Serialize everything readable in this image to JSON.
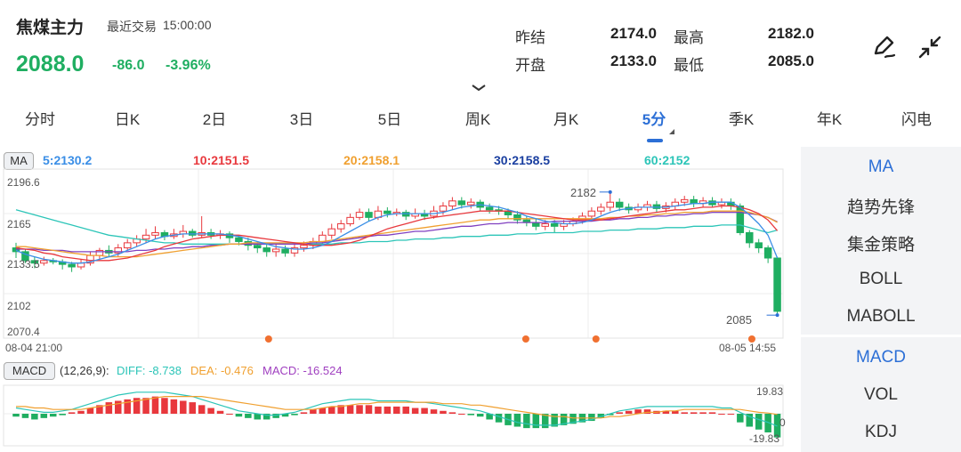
{
  "header": {
    "title": "焦煤主力",
    "last_trade_label": "最近交易",
    "last_trade_time": "15:00:00",
    "price": "2088.0",
    "change": "-86.0",
    "change_pct": "-3.96%",
    "prev_settle_label": "昨结",
    "prev_settle": "2174.0",
    "high_label": "最高",
    "high": "2182.0",
    "open_label": "开盘",
    "open": "2133.0",
    "low_label": "最低",
    "low": "2085.0"
  },
  "tabs": [
    "分时",
    "日K",
    "2日",
    "3日",
    "5日",
    "周K",
    "月K",
    "5分",
    "季K",
    "年K",
    "闪电"
  ],
  "active_tab": "5分",
  "ma": {
    "tag": "MA",
    "ma5": "5:2130.2",
    "ma10": "10:2151.5",
    "ma20": "20:2158.1",
    "ma30": "30:2158.5",
    "ma60": "60:2152"
  },
  "macd": {
    "tag": "MACD",
    "params": "(12,26,9):",
    "diff": "DIFF: -8.738",
    "dea": "DEA: -0.476",
    "macd": "MACD: -16.524"
  },
  "axis": {
    "y_ticks": [
      "2196.6",
      "2165",
      "2133.5",
      "2102",
      "2070.4"
    ],
    "x_start": "08-04 21:00",
    "x_end": "08-05 14:55",
    "macd_top": "19.83",
    "macd_zero": "0",
    "macd_bottom": "-19.83",
    "high_mark": "2182",
    "low_mark": "2085"
  },
  "side_menu": [
    "MA",
    "趋势先锋",
    "集金策略",
    "BOLL",
    "MABOLL",
    "MACD",
    "VOL",
    "KDJ"
  ],
  "colors": {
    "up": "#e8383d",
    "down": "#1fae61",
    "active": "#2c6fd6",
    "ma5": "#3a8ee6",
    "ma10": "#e8383d",
    "ma20": "#f0a030",
    "ma30": "#1a3fa0",
    "ma60": "#2cc5b8"
  },
  "chart_data": {
    "type": "candlestick",
    "ylim": [
      2070.4,
      2196.6
    ],
    "candles": [
      [
        2138,
        2135,
        2142,
        2130
      ],
      [
        2135,
        2128,
        2137,
        2126
      ],
      [
        2128,
        2126,
        2131,
        2122
      ],
      [
        2126,
        2128,
        2131,
        2124
      ],
      [
        2128,
        2127,
        2130,
        2125
      ],
      [
        2127,
        2125,
        2129,
        2121
      ],
      [
        2125,
        2123,
        2127,
        2119
      ],
      [
        2123,
        2126,
        2129,
        2121
      ],
      [
        2126,
        2132,
        2135,
        2124
      ],
      [
        2132,
        2136,
        2138,
        2129
      ],
      [
        2136,
        2134,
        2140,
        2131
      ],
      [
        2134,
        2138,
        2141,
        2131
      ],
      [
        2138,
        2142,
        2145,
        2136
      ],
      [
        2142,
        2145,
        2148,
        2139
      ],
      [
        2145,
        2148,
        2153,
        2142
      ],
      [
        2148,
        2150,
        2155,
        2145
      ],
      [
        2150,
        2147,
        2152,
        2144
      ],
      [
        2147,
        2149,
        2153,
        2145
      ],
      [
        2149,
        2151,
        2156,
        2146
      ],
      [
        2151,
        2148,
        2153,
        2146
      ],
      [
        2148,
        2150,
        2163,
        2146
      ],
      [
        2150,
        2148,
        2153,
        2145
      ],
      [
        2148,
        2149,
        2152,
        2145
      ],
      [
        2149,
        2146,
        2151,
        2142
      ],
      [
        2146,
        2143,
        2148,
        2140
      ],
      [
        2143,
        2140,
        2146,
        2136
      ],
      [
        2140,
        2138,
        2143,
        2134
      ],
      [
        2138,
        2135,
        2141,
        2131
      ],
      [
        2135,
        2137,
        2142,
        2131
      ],
      [
        2137,
        2134,
        2140,
        2131
      ],
      [
        2134,
        2138,
        2142,
        2131
      ],
      [
        2138,
        2140,
        2143,
        2135
      ],
      [
        2140,
        2143,
        2146,
        2137
      ],
      [
        2143,
        2148,
        2151,
        2141
      ],
      [
        2148,
        2153,
        2157,
        2145
      ],
      [
        2153,
        2157,
        2160,
        2150
      ],
      [
        2157,
        2162,
        2165,
        2155
      ],
      [
        2162,
        2166,
        2169,
        2160
      ],
      [
        2166,
        2162,
        2169,
        2159
      ],
      [
        2162,
        2167,
        2171,
        2160
      ],
      [
        2167,
        2165,
        2170,
        2162
      ],
      [
        2165,
        2166,
        2169,
        2163
      ],
      [
        2166,
        2163,
        2168,
        2160
      ],
      [
        2163,
        2165,
        2169,
        2161
      ],
      [
        2165,
        2163,
        2168,
        2160
      ],
      [
        2163,
        2167,
        2171,
        2161
      ],
      [
        2167,
        2171,
        2174,
        2164
      ],
      [
        2171,
        2175,
        2178,
        2168
      ],
      [
        2175,
        2172,
        2178,
        2169
      ],
      [
        2172,
        2174,
        2177,
        2169
      ],
      [
        2174,
        2170,
        2176,
        2167
      ],
      [
        2170,
        2168,
        2173,
        2165
      ],
      [
        2168,
        2167,
        2171,
        2164
      ],
      [
        2167,
        2164,
        2169,
        2161
      ],
      [
        2164,
        2160,
        2167,
        2157
      ],
      [
        2160,
        2158,
        2163,
        2155
      ],
      [
        2158,
        2155,
        2161,
        2152
      ],
      [
        2155,
        2157,
        2160,
        2152
      ],
      [
        2157,
        2155,
        2160,
        2150
      ],
      [
        2155,
        2157,
        2160,
        2152
      ],
      [
        2157,
        2159,
        2162,
        2155
      ],
      [
        2159,
        2163,
        2166,
        2157
      ],
      [
        2163,
        2167,
        2170,
        2160
      ],
      [
        2167,
        2170,
        2173,
        2164
      ],
      [
        2170,
        2174,
        2182,
        2167
      ],
      [
        2174,
        2170,
        2177,
        2167
      ],
      [
        2170,
        2168,
        2173,
        2165
      ],
      [
        2168,
        2170,
        2173,
        2166
      ],
      [
        2170,
        2172,
        2175,
        2167
      ],
      [
        2172,
        2169,
        2175,
        2166
      ],
      [
        2169,
        2171,
        2174,
        2166
      ],
      [
        2171,
        2174,
        2177,
        2168
      ],
      [
        2174,
        2176,
        2179,
        2171
      ],
      [
        2176,
        2173,
        2179,
        2170
      ],
      [
        2173,
        2175,
        2178,
        2170
      ],
      [
        2175,
        2172,
        2178,
        2170
      ],
      [
        2172,
        2174,
        2177,
        2169
      ],
      [
        2174,
        2171,
        2177,
        2168
      ],
      [
        2171,
        2150,
        2173,
        2148
      ],
      [
        2150,
        2142,
        2152,
        2138
      ],
      [
        2142,
        2138,
        2145,
        2134
      ],
      [
        2138,
        2130,
        2140,
        2126
      ],
      [
        2130,
        2088,
        2131,
        2085
      ]
    ],
    "ma5": [
      2136,
      2133,
      2131,
      2129,
      2128,
      2127,
      2126,
      2126,
      2127,
      2129,
      2131,
      2133,
      2136,
      2139,
      2142,
      2145,
      2147,
      2148,
      2149,
      2149,
      2149,
      2149,
      2149,
      2148,
      2147,
      2145,
      2143,
      2141,
      2139,
      2138,
      2137,
      2137,
      2138,
      2140,
      2143,
      2147,
      2151,
      2155,
      2159,
      2162,
      2164,
      2165,
      2165,
      2165,
      2165,
      2165,
      2166,
      2168,
      2170,
      2171,
      2172,
      2171,
      2170,
      2168,
      2166,
      2163,
      2161,
      2159,
      2158,
      2157,
      2157,
      2158,
      2160,
      2163,
      2166,
      2168,
      2169,
      2170,
      2170,
      2170,
      2170,
      2171,
      2172,
      2173,
      2173,
      2174,
      2174,
      2174,
      2170,
      2164,
      2157,
      2148,
      2130
    ],
    "ma10": [
      2138,
      2137,
      2136,
      2134,
      2133,
      2131,
      2130,
      2129,
      2128,
      2128,
      2128,
      2129,
      2130,
      2132,
      2134,
      2136,
      2139,
      2141,
      2143,
      2145,
      2146,
      2147,
      2148,
      2148,
      2148,
      2147,
      2146,
      2145,
      2144,
      2143,
      2142,
      2141,
      2140,
      2140,
      2140,
      2141,
      2142,
      2144,
      2147,
      2150,
      2153,
      2155,
      2157,
      2159,
      2161,
      2162,
      2163,
      2164,
      2165,
      2166,
      2167,
      2167,
      2167,
      2167,
      2166,
      2165,
      2164,
      2163,
      2162,
      2161,
      2160,
      2160,
      2160,
      2160,
      2161,
      2162,
      2163,
      2164,
      2165,
      2166,
      2167,
      2168,
      2168,
      2169,
      2170,
      2170,
      2171,
      2171,
      2170,
      2168,
      2165,
      2160,
      2151.5
    ],
    "ma20": [
      2139,
      2139,
      2138,
      2137,
      2136,
      2135,
      2134,
      2133,
      2132,
      2132,
      2131,
      2131,
      2131,
      2131,
      2132,
      2133,
      2134,
      2135,
      2136,
      2137,
      2138,
      2139,
      2140,
      2141,
      2141,
      2142,
      2142,
      2142,
      2142,
      2142,
      2142,
      2142,
      2143,
      2143,
      2144,
      2145,
      2146,
      2147,
      2148,
      2149,
      2150,
      2151,
      2152,
      2153,
      2154,
      2155,
      2156,
      2157,
      2158,
      2159,
      2160,
      2160,
      2161,
      2161,
      2161,
      2161,
      2161,
      2161,
      2161,
      2161,
      2161,
      2161,
      2161,
      2161,
      2162,
      2162,
      2163,
      2163,
      2164,
      2164,
      2165,
      2165,
      2166,
      2166,
      2166,
      2167,
      2167,
      2167,
      2167,
      2166,
      2164,
      2162,
      2158.1
    ],
    "ma30": [
      2137,
      2137,
      2137,
      2136,
      2136,
      2136,
      2135,
      2135,
      2135,
      2135,
      2135,
      2135,
      2135,
      2136,
      2136,
      2137,
      2137,
      2138,
      2138,
      2139,
      2139,
      2140,
      2140,
      2141,
      2141,
      2141,
      2141,
      2141,
      2141,
      2141,
      2141,
      2141,
      2142,
      2142,
      2143,
      2144,
      2145,
      2146,
      2147,
      2148,
      2148,
      2149,
      2150,
      2151,
      2151,
      2152,
      2153,
      2154,
      2155,
      2155,
      2156,
      2157,
      2157,
      2158,
      2158,
      2158,
      2158,
      2158,
      2159,
      2159,
      2159,
      2159,
      2159,
      2160,
      2160,
      2161,
      2161,
      2162,
      2162,
      2163,
      2163,
      2164,
      2164,
      2165,
      2165,
      2166,
      2166,
      2166,
      2166,
      2165,
      2164,
      2162,
      2158.5
    ],
    "ma60": [
      2168,
      2166,
      2164,
      2162,
      2160,
      2158,
      2156,
      2154,
      2152,
      2150,
      2148,
      2147,
      2146,
      2145,
      2144,
      2143,
      2142,
      2142,
      2141,
      2141,
      2141,
      2141,
      2141,
      2141,
      2141,
      2141,
      2141,
      2141,
      2141,
      2141,
      2141,
      2141,
      2141,
      2141,
      2141,
      2142,
      2142,
      2142,
      2143,
      2143,
      2143,
      2144,
      2144,
      2145,
      2145,
      2145,
      2146,
      2146,
      2147,
      2147,
      2147,
      2148,
      2148,
      2148,
      2149,
      2149,
      2149,
      2150,
      2150,
      2150,
      2150,
      2151,
      2151,
      2151,
      2152,
      2152,
      2152,
      2153,
      2153,
      2153,
      2154,
      2154,
      2154,
      2155,
      2155,
      2155,
      2156,
      2156,
      2156,
      2154,
      2152,
      2150,
      2152
    ],
    "macd_hist": [
      -2,
      -3,
      -4,
      -3,
      -2,
      -1,
      1,
      2,
      4,
      6,
      8,
      9,
      10,
      11,
      11,
      12,
      11,
      10,
      9,
      8,
      6,
      4,
      2,
      0,
      -2,
      -3,
      -4,
      -4,
      -3,
      -2,
      -1,
      1,
      3,
      4,
      5,
      6,
      6,
      6,
      6,
      5,
      5,
      5,
      5,
      4,
      4,
      3,
      2,
      1,
      0,
      -1,
      -2,
      -4,
      -6,
      -8,
      -9,
      -10,
      -10,
      -10,
      -9,
      -8,
      -7,
      -6,
      -5,
      -3,
      -1,
      1,
      2,
      3,
      3,
      2,
      2,
      2,
      1,
      1,
      1,
      1,
      0,
      0,
      -6,
      -9,
      -11,
      -13,
      -16.5
    ],
    "diff": [
      4,
      3,
      2,
      1,
      1,
      2,
      3,
      5,
      7,
      9,
      11,
      13,
      14,
      15,
      15,
      15,
      15,
      14,
      13,
      12,
      10,
      8,
      6,
      4,
      2,
      1,
      0,
      -1,
      -1,
      0,
      1,
      3,
      5,
      7,
      8,
      9,
      10,
      10,
      10,
      9,
      9,
      9,
      9,
      8,
      8,
      7,
      6,
      5,
      4,
      3,
      2,
      0,
      -2,
      -4,
      -6,
      -7,
      -8,
      -8,
      -8,
      -7,
      -6,
      -5,
      -4,
      -2,
      0,
      2,
      3,
      4,
      5,
      5,
      5,
      5,
      5,
      5,
      5,
      5,
      4,
      4,
      1,
      -2,
      -4,
      -6,
      -8.7
    ],
    "dea": [
      5,
      5,
      4,
      4,
      3,
      3,
      3,
      3,
      4,
      5,
      6,
      7,
      8,
      9,
      10,
      11,
      12,
      12,
      12,
      12,
      12,
      11,
      10,
      9,
      8,
      7,
      6,
      5,
      4,
      3,
      3,
      3,
      3,
      4,
      5,
      5,
      6,
      7,
      7,
      8,
      8,
      8,
      8,
      8,
      8,
      8,
      7,
      7,
      7,
      6,
      6,
      5,
      4,
      3,
      2,
      1,
      0,
      -1,
      -2,
      -2,
      -3,
      -3,
      -3,
      -3,
      -2,
      -2,
      -1,
      0,
      1,
      1,
      2,
      2,
      3,
      3,
      3,
      3,
      3,
      3,
      3,
      2,
      1,
      0.5,
      -0.5
    ]
  }
}
